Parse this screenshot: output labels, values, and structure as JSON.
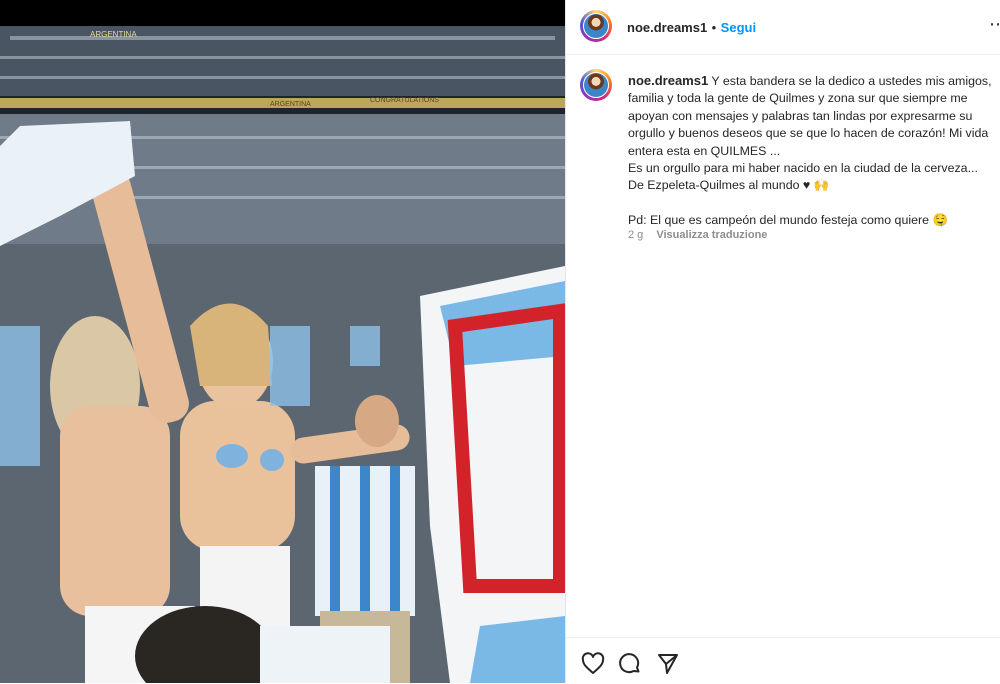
{
  "post": {
    "username": "noe.dreams1",
    "separator": "•",
    "follow_label": "Segui",
    "more_icon": "⋯",
    "caption": {
      "username": "noe.dreams1",
      "line1": "Y esta bandera se la dedico a ustedes mis amigos, familia y toda la gente de Quilmes y zona sur que siempre me apoyan con mensajes y palabras tan lindas por expresarme su orgullo y buenos deseos que se que lo hacen de corazón! Mi vida entera esta en QUILMES ...",
      "line2": "Es un orgullo para mi haber nacido en la ciudad de la cerveza...",
      "line3": "De Ezpeleta-Quilmes al mundo ♥ 🙌",
      "line4": "Pd: El que es campeón del mundo festeja como quiere 🤤"
    },
    "time_ago": "2 g",
    "translate_label": "Visualizza traduzione"
  },
  "stadium_banners": [
    "ARGENTINA",
    "CONGRATULATIONS",
    "ARGENTINA"
  ],
  "icons": {
    "like": "heart-icon",
    "comment": "comment-icon",
    "share": "send-icon"
  }
}
